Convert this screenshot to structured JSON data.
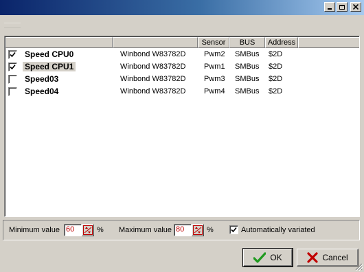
{
  "window": {
    "title": "",
    "buttons": {
      "minimize": "_",
      "maximize": "□",
      "close": "×"
    }
  },
  "list": {
    "columns": [
      {
        "key": "name",
        "label": ""
      },
      {
        "key": "chip",
        "label": ""
      },
      {
        "key": "sensor",
        "label": "Sensor"
      },
      {
        "key": "bus",
        "label": "BUS"
      },
      {
        "key": "address",
        "label": "Address"
      }
    ],
    "rows": [
      {
        "checked": true,
        "name": "Speed CPU0",
        "chip": "Winbond W83782D",
        "sensor": "Pwm2",
        "bus": "SMBus",
        "address": "$2D"
      },
      {
        "checked": true,
        "name": "Speed CPU1",
        "chip": "Winbond W83782D",
        "sensor": "Pwm1",
        "bus": "SMBus",
        "address": "$2D",
        "selected": true
      },
      {
        "checked": false,
        "name": "Speed03",
        "chip": "Winbond W83782D",
        "sensor": "Pwm3",
        "bus": "SMBus",
        "address": "$2D"
      },
      {
        "checked": false,
        "name": "Speed04",
        "chip": "Winbond W83782D",
        "sensor": "Pwm4",
        "bus": "SMBus",
        "address": "$2D"
      }
    ]
  },
  "options": {
    "min_label": "Minimum value",
    "min_value": "60",
    "min_unit": "%",
    "max_label": "Maximum value",
    "max_value": "80",
    "max_unit": "%",
    "auto_label": "Automatically variated",
    "auto_checked": true
  },
  "footer": {
    "ok_label": "OK",
    "cancel_label": "Cancel"
  },
  "colors": {
    "title_start": "#0a246a",
    "title_end": "#a6caf0",
    "face": "#d4d0c8",
    "spin_value": "#c00000",
    "ok_icon": "#1f9a1f",
    "cancel_icon": "#c00000"
  },
  "icons": {
    "ok": "green-check-icon",
    "cancel": "red-x-icon",
    "spin": "spin-arrows-icon"
  }
}
